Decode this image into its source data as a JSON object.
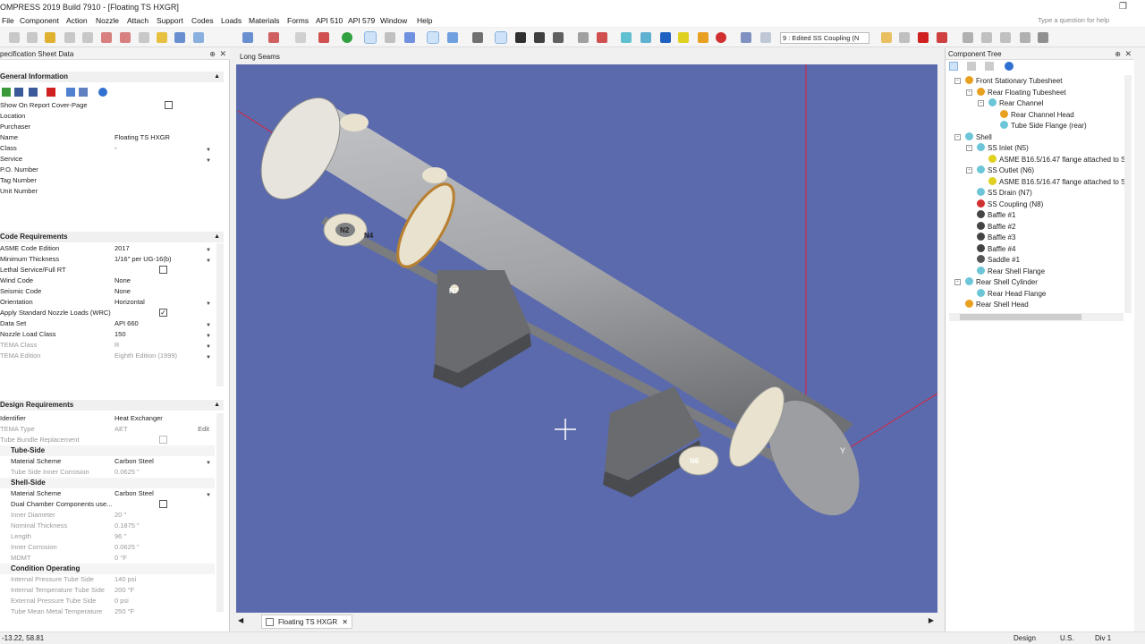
{
  "window": {
    "title": "OMPRESS 2019 Build 7910 - [Floating TS HXGR]",
    "restore_glyph": "❐"
  },
  "menu": [
    "File",
    "Component",
    "Action",
    "Nozzle",
    "Attach",
    "Support",
    "Codes",
    "Loads",
    "Materials",
    "Forms",
    "API 510",
    "API 579",
    "Window",
    "Help"
  ],
  "help_search_placeholder": "Type a question for help",
  "toolbar": {
    "view_combo": "9 : Edited SS Coupling (N"
  },
  "left_panel": {
    "title": "pecification Sheet Data",
    "general": {
      "title": "General Information",
      "rows": [
        {
          "label": "Show On Report Cover-Page",
          "value": ""
        },
        {
          "label": "Location",
          "value": ""
        },
        {
          "label": "Purchaser",
          "value": ""
        },
        {
          "label": "Name",
          "value": "Floating TS HXGR"
        },
        {
          "label": "Class",
          "value": "-"
        },
        {
          "label": "Service",
          "value": ""
        },
        {
          "label": "P.O. Number",
          "value": ""
        },
        {
          "label": "Tag Number",
          "value": ""
        },
        {
          "label": "Unit Number",
          "value": ""
        }
      ]
    },
    "code": {
      "title": "Code Requirements",
      "rows": [
        {
          "label": "ASME Code Edition",
          "value": "2017"
        },
        {
          "label": "Minimum Thickness",
          "value": "1/16\" per UG-16(b)"
        },
        {
          "label": "Lethal Service/Full RT",
          "value": ""
        },
        {
          "label": "Wind Code",
          "value": "None"
        },
        {
          "label": "Seismic Code",
          "value": "None"
        },
        {
          "label": "Orientation",
          "value": "Horizontal"
        },
        {
          "label": "Apply Standard Nozzle Loads (WRC)",
          "value": ""
        },
        {
          "label": "Data Set",
          "value": "API 660"
        },
        {
          "label": "Nozzle Load Class",
          "value": "150"
        },
        {
          "label": "TEMA Class",
          "value": "R"
        },
        {
          "label": "TEMA Edition",
          "value": "Eighth Edition (1999)"
        }
      ]
    },
    "design": {
      "title": "Design Requirements",
      "rows": [
        {
          "label": "Identifier",
          "value": "Heat Exchanger"
        },
        {
          "label": "TEMA Type",
          "value": "AET",
          "extra": "Edit"
        },
        {
          "label": "Tube Bundle Replacement",
          "value": ""
        }
      ],
      "tube_side": {
        "title": "Tube-Side",
        "rows": [
          {
            "label": "Material Scheme",
            "value": "Carbon Steel"
          },
          {
            "label": "Tube Side Inner Corrosion",
            "value": "0.0625 \""
          }
        ]
      },
      "shell_side": {
        "title": "Shell-Side",
        "rows": [
          {
            "label": "Material Scheme",
            "value": "Carbon Steel"
          },
          {
            "label": "Dual Chamber Components use...",
            "value": ""
          },
          {
            "label": "Inner Diameter",
            "value": "20 \""
          },
          {
            "label": "Nominal Thickness",
            "value": "0.1875 \""
          },
          {
            "label": "Length",
            "value": "96 \""
          },
          {
            "label": "Inner Corrosion",
            "value": "0.0625 \""
          },
          {
            "label": "MDMT",
            "value": "0 °F"
          }
        ]
      },
      "condition": {
        "title": "Condition Operating",
        "rows": [
          {
            "label": "Internal Pressure Tube Side",
            "value": "140 psi"
          },
          {
            "label": "Internal Temperature Tube Side",
            "value": "200 °F"
          },
          {
            "label": "External Pressure Tube Side",
            "value": "0 psi"
          },
          {
            "label": "Tube Mean Metal Temperature",
            "value": "250 °F"
          }
        ]
      }
    }
  },
  "viewport": {
    "title": "Long Seams",
    "nozzle_labels": [
      "N2",
      "N4",
      "N7",
      "N6"
    ],
    "axis_label": "Y"
  },
  "doc_tab": {
    "label": "Floating TS HXGR",
    "close": "✕"
  },
  "right_panel": {
    "title": "Component Tree",
    "tree": [
      {
        "label": "Front Stationary Tubesheet",
        "level": 0,
        "color": "#e8a020",
        "exp": "-"
      },
      {
        "label": "Rear Floating Tubesheet",
        "level": 1,
        "color": "#e8a020",
        "exp": "-"
      },
      {
        "label": "Rear Channel",
        "level": 2,
        "color": "#6cc6d8",
        "exp": "-"
      },
      {
        "label": "Rear Channel Head",
        "level": 3,
        "color": "#e8a020",
        "exp": ""
      },
      {
        "label": "Tube Side Flange (rear)",
        "level": 3,
        "color": "#6cc6d8",
        "exp": ""
      },
      {
        "label": "Shell",
        "level": 0,
        "color": "#6cc6d8",
        "exp": "-"
      },
      {
        "label": "SS Inlet (N5)",
        "level": 1,
        "color": "#6cc6d8",
        "exp": "-"
      },
      {
        "label": "ASME B16.5/16.47 flange attached to S",
        "level": 2,
        "color": "#e0d020",
        "exp": ""
      },
      {
        "label": "SS Outlet (N6)",
        "level": 1,
        "color": "#6cc6d8",
        "exp": "-"
      },
      {
        "label": "ASME B16.5/16.47 flange attached to S",
        "level": 2,
        "color": "#e0d020",
        "exp": ""
      },
      {
        "label": "SS Drain (N7)",
        "level": 1,
        "color": "#6cc6d8",
        "exp": ""
      },
      {
        "label": "SS Coupling (N8)",
        "level": 1,
        "color": "#d03030",
        "exp": ""
      },
      {
        "label": "Baffle #1",
        "level": 1,
        "color": "#444444",
        "exp": ""
      },
      {
        "label": "Baffle #2",
        "level": 1,
        "color": "#444444",
        "exp": ""
      },
      {
        "label": "Baffle #3",
        "level": 1,
        "color": "#444444",
        "exp": ""
      },
      {
        "label": "Baffle #4",
        "level": 1,
        "color": "#444444",
        "exp": ""
      },
      {
        "label": "Saddle #1",
        "level": 1,
        "color": "#555555",
        "exp": ""
      },
      {
        "label": "Rear Shell Flange",
        "level": 1,
        "color": "#6cc6d8",
        "exp": ""
      },
      {
        "label": "Rear Shell Cylinder",
        "level": 0,
        "color": "#6cc6d8",
        "exp": "-"
      },
      {
        "label": "Rear Head Flange",
        "level": 1,
        "color": "#6cc6d8",
        "exp": ""
      },
      {
        "label": "Rear Shell Head",
        "level": 0,
        "color": "#e8a020",
        "exp": ""
      }
    ]
  },
  "status": {
    "coords": "-13.22, 58.81",
    "mode": "Design",
    "units": "U.S.",
    "division": "Div 1"
  },
  "colors": {
    "viewport_bg": "#5b6aac",
    "vessel": "#9a9da2",
    "flange": "#e8e2cf",
    "saddle": "#5c5d60",
    "axis": "#e0203a"
  }
}
